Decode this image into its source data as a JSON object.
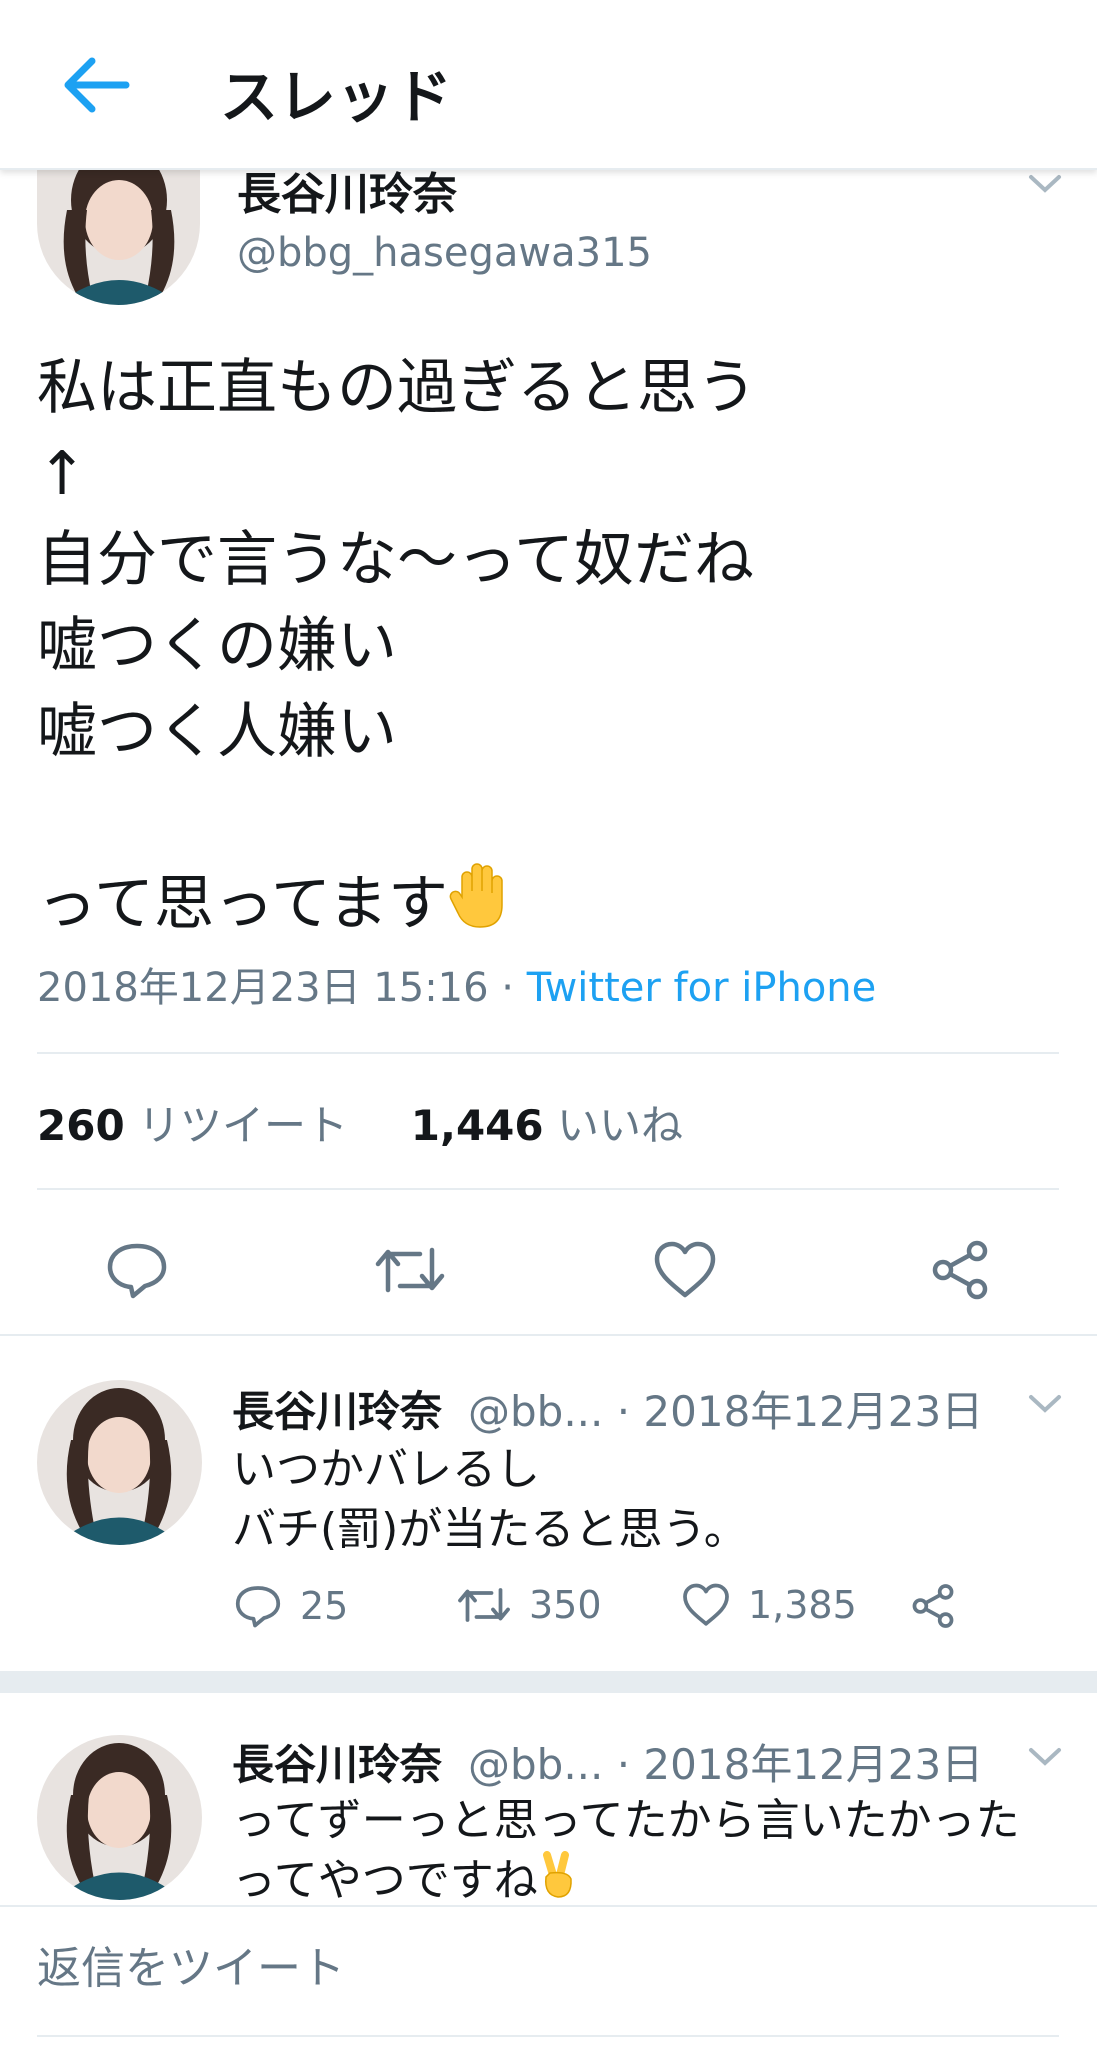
{
  "header": {
    "title": "スレッド"
  },
  "main_tweet": {
    "name": "長谷川玲奈",
    "handle": "@bbg_hasegawa315",
    "text": "私は正直もの過ぎると思う\n↑\n自分で言うな〜って奴だね\n嘘つくの嫌い\n嘘つく人嫌い\n\nって思ってます",
    "timestamp": "2018年12月23日 15:16",
    "separator": " · ",
    "source": "Twitter for iPhone",
    "retweet_count": "260",
    "retweet_label": "リツイート",
    "like_count": "1,446",
    "like_label": "いいね"
  },
  "replies": [
    {
      "name": "長谷川玲奈",
      "handle": "@bb...",
      "date": "· 2018年12月23日",
      "text": "いつかバレるし\nバチ(罰)が当たると思う。",
      "reply_count": "25",
      "retweet_count": "350",
      "like_count": "1,385"
    },
    {
      "name": "長谷川玲奈",
      "handle": "@bb...",
      "date": "· 2018年12月23日",
      "text": "ってずーっと思ってたから言いたかった\nってやつですね"
    }
  ],
  "reply_bar": {
    "placeholder": "返信をツイート"
  },
  "colors": {
    "accent": "#1da1f2",
    "text": "#14171a",
    "secondary": "#657786",
    "border": "#e6ecf0"
  },
  "icons": [
    "back-arrow-icon",
    "chevron-down-icon",
    "reply-icon",
    "retweet-icon",
    "like-icon",
    "share-icon",
    "raised-hand-emoji",
    "victory-hand-emoji"
  ]
}
